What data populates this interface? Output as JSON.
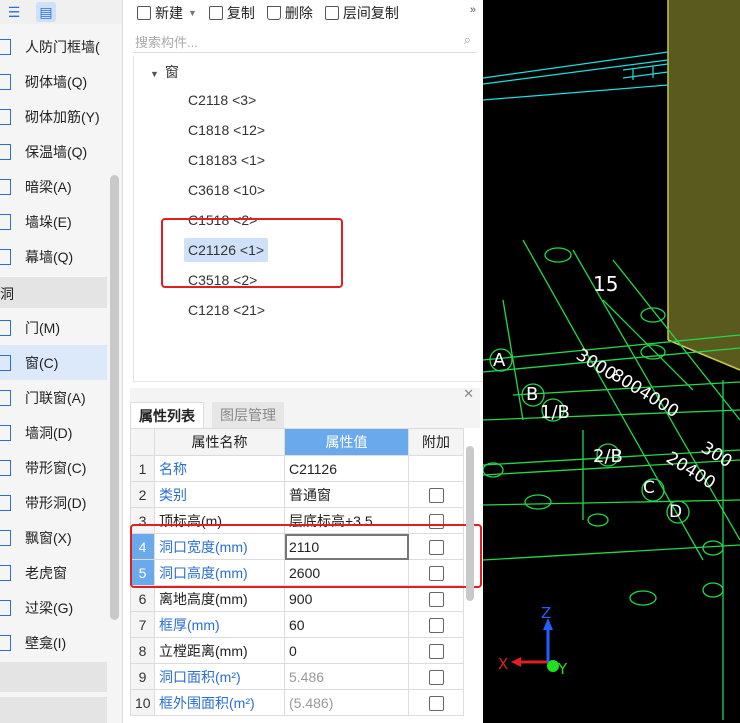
{
  "sidebar": {
    "items": [
      {
        "label": "人防门框墙(",
        "icon": "wall-icon"
      },
      {
        "label": "砌体墙(Q)",
        "icon": "masonry-wall-icon"
      },
      {
        "label": "砌体加筋(Y)",
        "icon": "masonry-rebar-icon"
      },
      {
        "label": "保温墙(Q)",
        "icon": "insulation-wall-icon"
      },
      {
        "label": "暗梁(A)",
        "icon": "hidden-beam-icon"
      },
      {
        "label": "墙垛(E)",
        "icon": "wall-pier-icon"
      },
      {
        "label": "幕墙(Q)",
        "icon": "curtain-wall-icon"
      }
    ],
    "group_label": "洞",
    "group_items": [
      {
        "label": "门(M)",
        "icon": "door-icon"
      },
      {
        "label": "窗(C)",
        "icon": "window-icon"
      },
      {
        "label": "门联窗(A)",
        "icon": "door-window-icon"
      },
      {
        "label": "墙洞(D)",
        "icon": "wall-opening-icon"
      },
      {
        "label": "带形窗(C)",
        "icon": "strip-window-icon"
      },
      {
        "label": "带形洞(D)",
        "icon": "strip-opening-icon"
      },
      {
        "label": "飘窗(X)",
        "icon": "bay-window-icon"
      },
      {
        "label": "老虎窗",
        "icon": "dormer-window-icon"
      },
      {
        "label": "过梁(G)",
        "icon": "lintel-icon"
      },
      {
        "label": "壁龛(I)",
        "icon": "niche-icon"
      }
    ]
  },
  "toolbar": {
    "new_label": "新建",
    "copy_label": "复制",
    "delete_label": "删除",
    "floor_copy_label": "层间复制"
  },
  "search": {
    "placeholder": "搜索构件..."
  },
  "tree": {
    "root_label": "窗",
    "items": [
      "C2118 <3>",
      "C1818 <12>",
      "C18183 <1>",
      "C3618 <10>",
      "C1518 <2>",
      "C21126 <1>",
      "C3518 <2>",
      "C1218 <21>"
    ],
    "selected_index": 5
  },
  "props": {
    "tab_active": "属性列表",
    "tab_inactive": "图层管理",
    "headers": {
      "name": "属性名称",
      "value": "属性值",
      "extra": "附加"
    },
    "rows": [
      {
        "num": "1",
        "name": "名称",
        "value": "C21126",
        "name_blue": true,
        "checkbox": false
      },
      {
        "num": "2",
        "name": "类别",
        "value": "普通窗",
        "name_blue": true,
        "checkbox": true
      },
      {
        "num": "3",
        "name": "顶标高(m)",
        "value": "层底标高+3.5",
        "name_blue": false,
        "checkbox": true
      },
      {
        "num": "4",
        "name": "洞口宽度(mm)",
        "value": "2110",
        "name_blue": true,
        "checkbox": true
      },
      {
        "num": "5",
        "name": "洞口高度(mm)",
        "value": "2600",
        "name_blue": true,
        "checkbox": true
      },
      {
        "num": "6",
        "name": "离地高度(mm)",
        "value": "900",
        "name_blue": false,
        "checkbox": true
      },
      {
        "num": "7",
        "name": "框厚(mm)",
        "value": "60",
        "name_blue": true,
        "checkbox": true
      },
      {
        "num": "8",
        "name": "立樘距离(mm)",
        "value": "0",
        "name_blue": false,
        "checkbox": true
      },
      {
        "num": "9",
        "name": "洞口面积(m²)",
        "value": "5.486",
        "name_blue": true,
        "checkbox": true
      },
      {
        "num": "10",
        "name": "框外围面积(m²)",
        "value": "(5.486)",
        "name_blue": true,
        "checkbox": true
      }
    ]
  },
  "cad": {
    "labels": [
      "15",
      "A",
      "B",
      "1/B",
      "2/B",
      "C",
      "D",
      "3000",
      "8004000",
      "20400",
      "300"
    ],
    "axis_labels": {
      "x": "X",
      "y": "Y",
      "z": "Z"
    },
    "colors": {
      "grid_green": "#22d84a",
      "grid_cyan": "#1ce0e0",
      "wall_olive": "#5a5a1e",
      "axis_red": "#e02020",
      "axis_blue": "#2060ff",
      "axis_green": "#20e020"
    }
  },
  "colors": {
    "accent": "#2a6fd6",
    "highlight": "#e02020",
    "header_blue": "#6aa9ec"
  }
}
